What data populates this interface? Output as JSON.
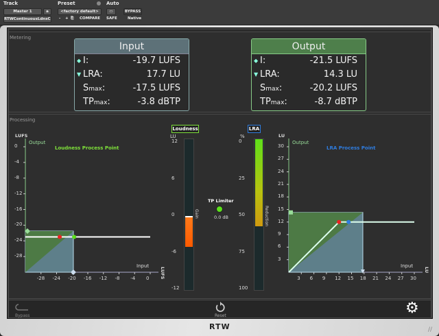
{
  "toolbar": {
    "track_label": "Track",
    "preset_label": "Preset",
    "auto_label": "Auto",
    "track_name": "Master 1",
    "track_variant": "a",
    "preset_value": "<factory default>",
    "bypass": "BYPASS",
    "plugin_name": "RTWContinuousLdnsCntrl",
    "minus": "-",
    "plus": "+",
    "compare": "COMPARE",
    "safe": "SAFE",
    "native": "Native"
  },
  "metering": {
    "label": "Metering",
    "input": {
      "title": "Input",
      "rows": [
        {
          "k": "I:",
          "v": "-19.7 LUFS"
        },
        {
          "k": "LRA:",
          "v": "17.7 LU"
        },
        {
          "k": "S",
          "sub": "max",
          "v": "-17.5 LUFS"
        },
        {
          "k": "TP",
          "sub": "max",
          "v": "-3.8 dBTP"
        }
      ]
    },
    "output": {
      "title": "Output",
      "rows": [
        {
          "k": "I:",
          "v": "-21.5 LUFS"
        },
        {
          "k": "LRA:",
          "v": "14.3 LU"
        },
        {
          "k": "S",
          "sub": "max",
          "v": "-20.2 LUFS"
        },
        {
          "k": "TP",
          "sub": "max",
          "v": "-8.7 dBTP"
        }
      ]
    }
  },
  "processing": {
    "label": "Processing",
    "loudness_meter": {
      "label": "Loudness",
      "unit": "LU",
      "side": "Gain",
      "ticks": [
        "12",
        "6",
        "0",
        "-6",
        "-12"
      ],
      "gain_from": 0,
      "gain_to": -5
    },
    "tp_limiter": {
      "label": "TP Limiter",
      "value": "0.0 dB"
    },
    "lra_meter": {
      "label": "LRA",
      "unit": "%",
      "side": "Reduction",
      "ticks": [
        "0",
        "25",
        "50",
        "75",
        "100"
      ],
      "reduction_percent": 57
    }
  },
  "chart_data": [
    {
      "type": "line",
      "title": "Loudness Process Point",
      "ylabel": "LUFS",
      "yname": "Output",
      "xname": "Input",
      "xunit": "LUFS",
      "xlim": [
        -32,
        0
      ],
      "ylim": [
        -32,
        0
      ],
      "xticks": [
        "-28",
        "-24",
        "-20",
        "-16",
        "-12",
        "-8",
        "-4",
        "0"
      ],
      "yticks": [
        "0",
        "-4",
        "-8",
        "-12",
        "-16",
        "-20",
        "-24",
        "-28"
      ],
      "input_loudness": -19.7,
      "output_loudness": -21.5,
      "target": -23,
      "process_point": -23.2,
      "target_input": -19.5,
      "color": "#7ee03a"
    },
    {
      "type": "line",
      "title": "LRA Process Point",
      "ylabel": "LU",
      "yname": "Output",
      "xname": "Input",
      "xunit": "LU",
      "xlim": [
        0,
        30
      ],
      "ylim": [
        0,
        30
      ],
      "xticks": [
        "3",
        "6",
        "9",
        "12",
        "15",
        "18",
        "21",
        "24",
        "27",
        "30"
      ],
      "yticks": [
        "30",
        "27",
        "24",
        "21",
        "18",
        "15",
        "12",
        "9",
        "6",
        "3"
      ],
      "input_lra": 17.7,
      "output_lra": 14.3,
      "max_lra": 12,
      "process_point": 12,
      "blue_point": 14.3,
      "color": "#2f7de0"
    }
  ],
  "bottom": {
    "bypass": "Bypass",
    "reset": "Reset"
  },
  "logo": "RTW"
}
